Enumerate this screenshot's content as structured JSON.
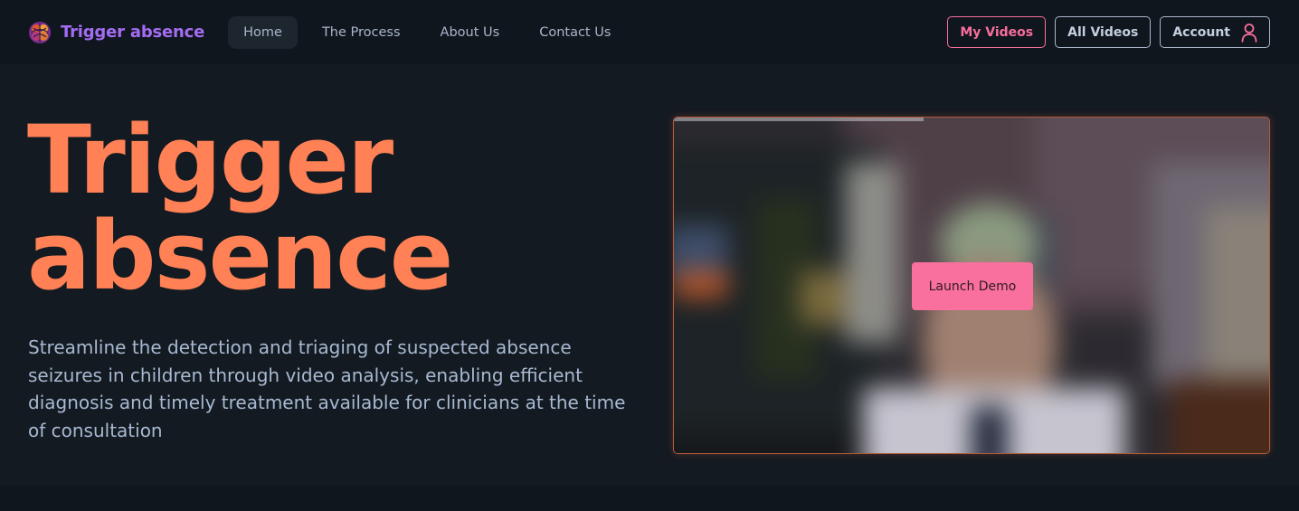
{
  "brand": {
    "name": "Trigger absence",
    "logo_icon": "brain-icon"
  },
  "nav": {
    "links": [
      {
        "label": "Home",
        "active": true
      },
      {
        "label": "The Process",
        "active": false
      },
      {
        "label": "About Us",
        "active": false
      },
      {
        "label": "Contact Us",
        "active": false
      }
    ],
    "my_videos_label": "My Videos",
    "all_videos_label": "All Videos",
    "account_label": "Account",
    "account_icon": "user-icon"
  },
  "hero": {
    "title_line1": "Trigger",
    "title_line2": "absence",
    "description": "Streamline the detection and triaging of suspected absence seizures in children through video analysis, enabling efficient diagnosis and timely treatment available for clinicians at the time of consultation"
  },
  "video": {
    "launch_label": "Launch Demo",
    "progress_fraction": 0.42
  },
  "colors": {
    "accent_orange": "#ff8155",
    "accent_pink": "#f76e9c",
    "brand_purple": "#a46cf2",
    "background": "#141a21",
    "navbar": "#10161d"
  }
}
